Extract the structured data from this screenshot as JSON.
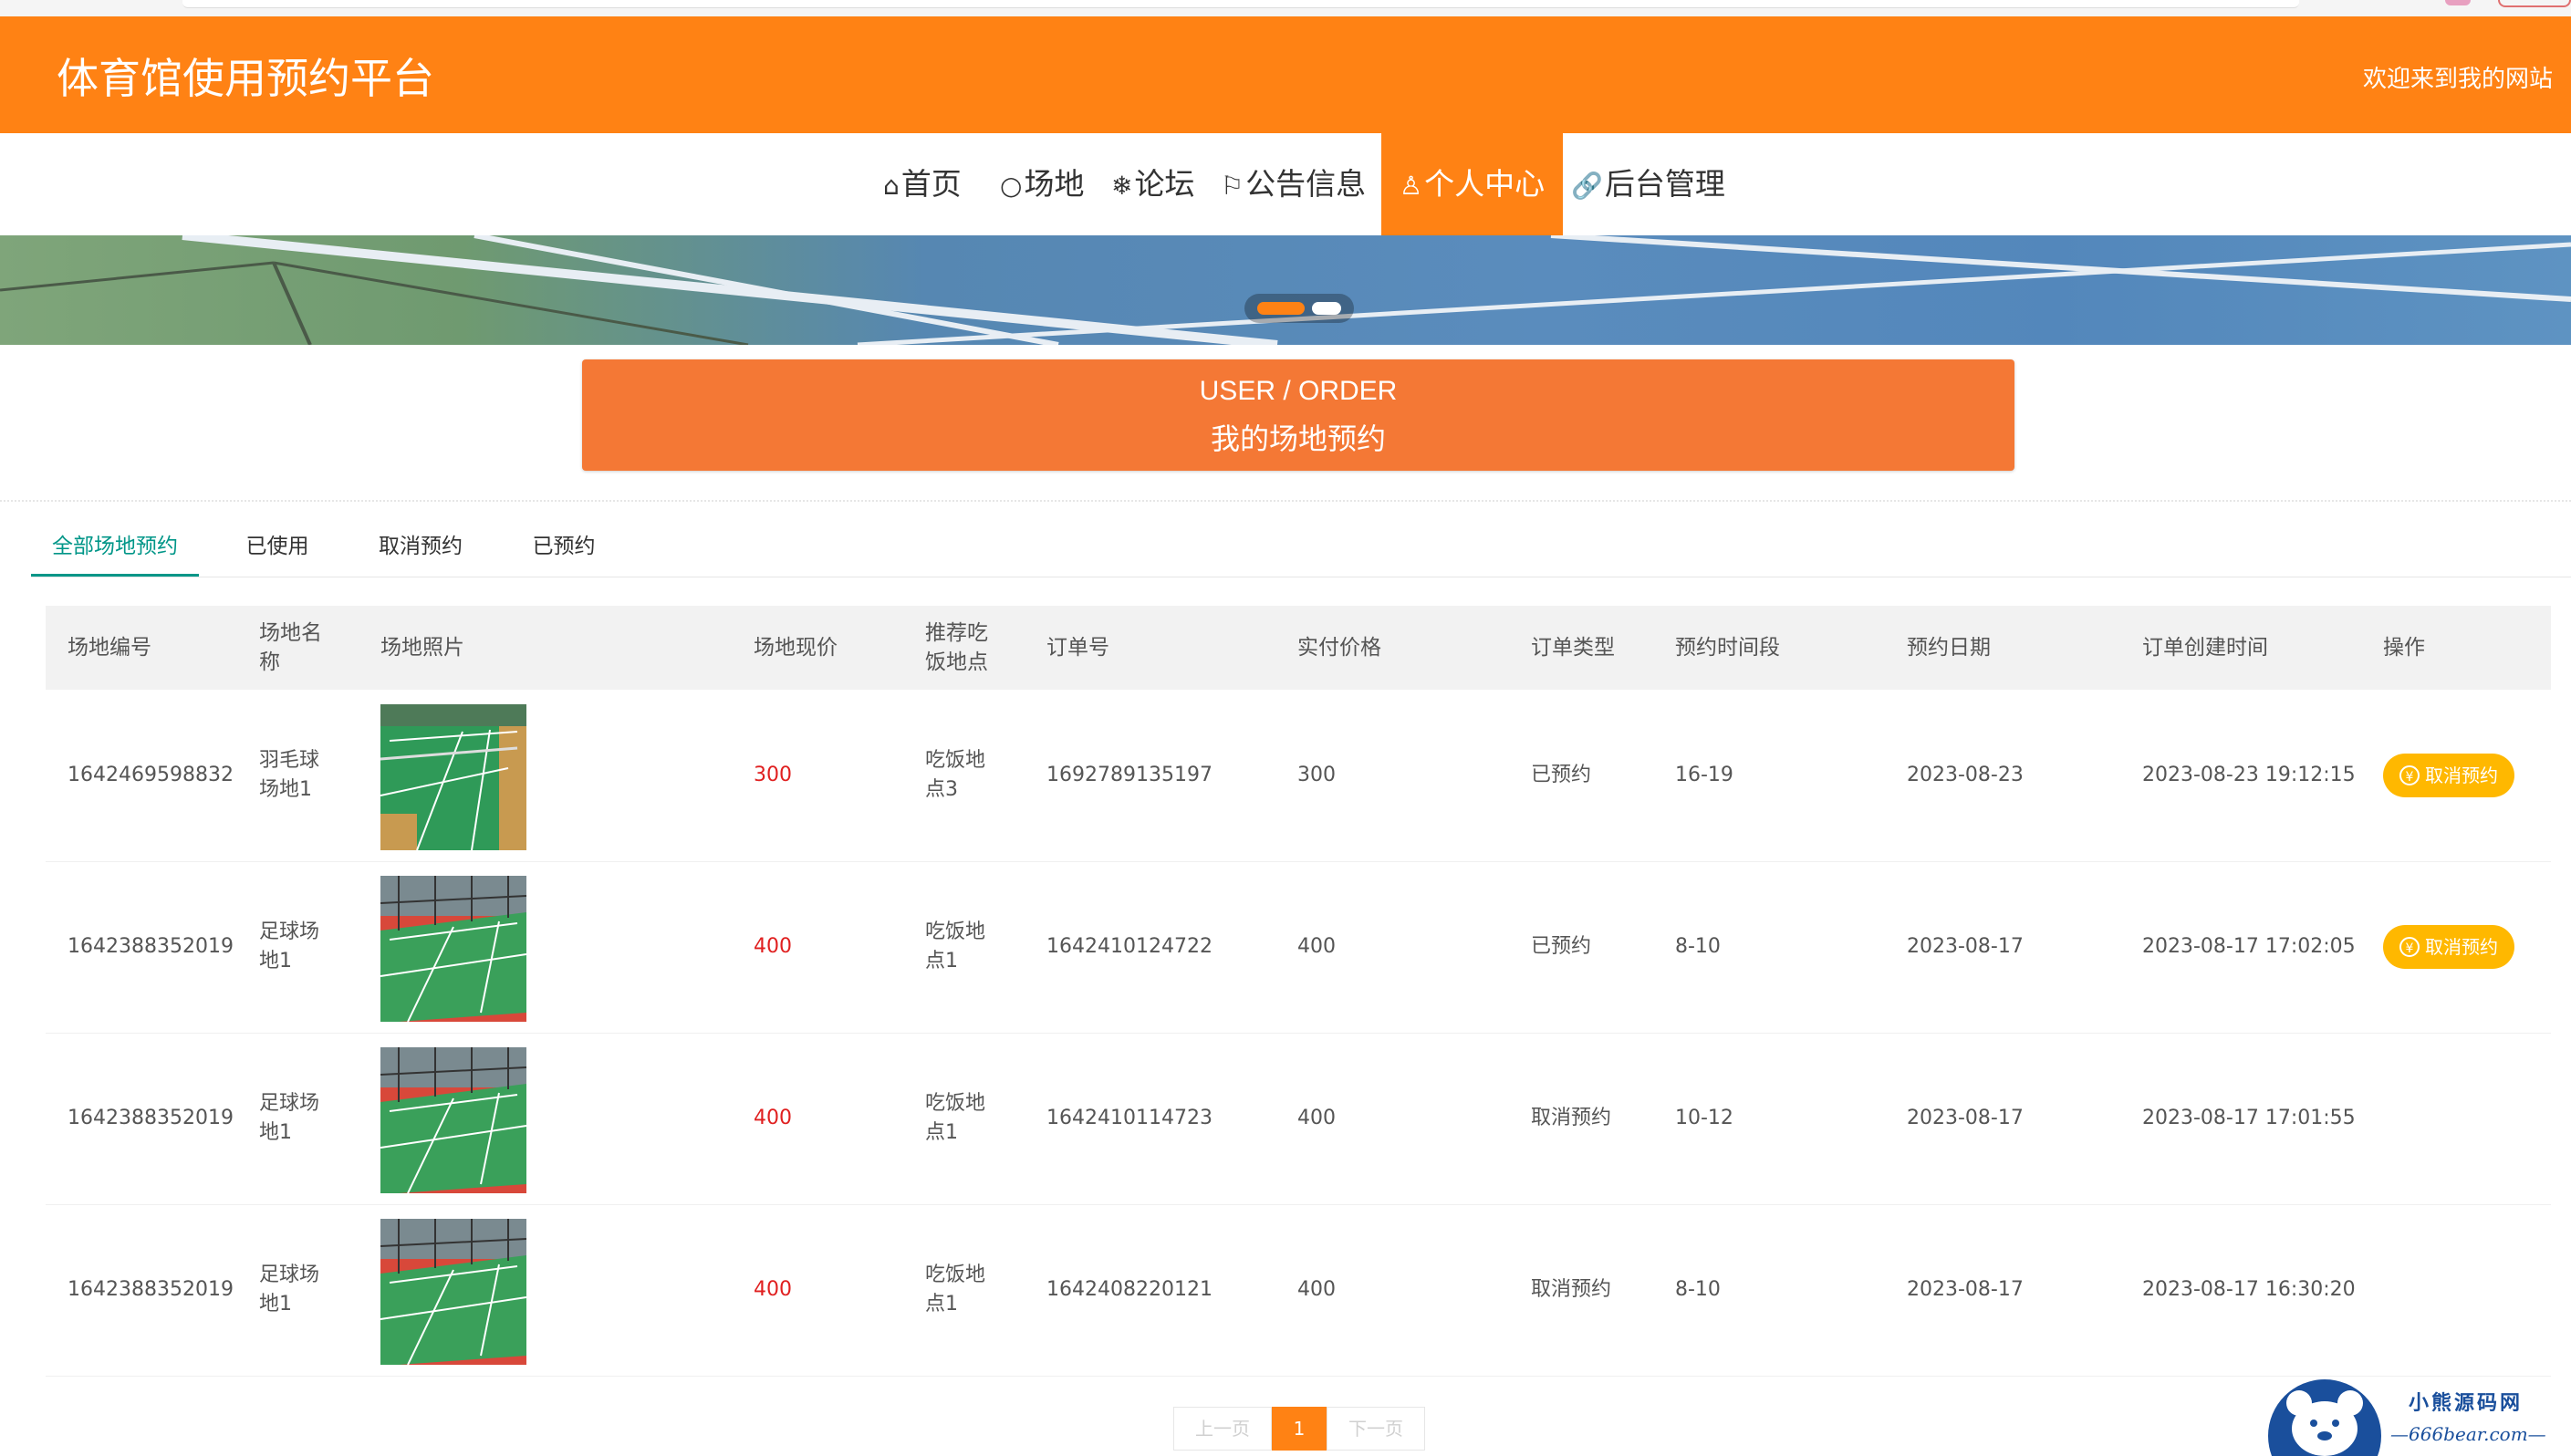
{
  "header": {
    "site_title": "体育馆使用预约平台",
    "welcome": "欢迎来到我的网站"
  },
  "nav": {
    "items": [
      {
        "label": "首页",
        "icon": "home-icon"
      },
      {
        "label": "场地",
        "icon": "circle-icon"
      },
      {
        "label": "论坛",
        "icon": "snowflake-icon"
      },
      {
        "label": "公告信息",
        "icon": "flag-icon"
      },
      {
        "label": "个人中心",
        "icon": "user-icon",
        "active": true
      },
      {
        "label": "后台管理",
        "icon": "link-icon"
      }
    ]
  },
  "banner": {
    "slides_total": 2,
    "active_slide": 1
  },
  "page_title": {
    "en": "USER / ORDER",
    "cn": "我的场地预约"
  },
  "tabs": [
    {
      "label": "全部场地预约",
      "active": true
    },
    {
      "label": "已使用"
    },
    {
      "label": "取消预约"
    },
    {
      "label": "已预约"
    }
  ],
  "table": {
    "headers": [
      "场地编号",
      "场地名称",
      "场地照片",
      "场地现价",
      "推荐吃饭地点",
      "订单号",
      "实付价格",
      "订单类型",
      "预约时间段",
      "预约日期",
      "订单创建时间",
      "操作"
    ],
    "rows": [
      {
        "venue_id": "1642469598832",
        "venue_name": "羽毛球场地1",
        "photo": "badminton-court",
        "price": "300",
        "food_spot": "吃饭地点3",
        "order_no": "1692789135197",
        "paid": "300",
        "order_type": "已预约",
        "time_slot": "16-19",
        "date": "2023-08-23",
        "created": "2023-08-23 19:12:15",
        "action": "取消预约"
      },
      {
        "venue_id": "1642388352019",
        "venue_name": "足球场地1",
        "photo": "court",
        "price": "400",
        "food_spot": "吃饭地点1",
        "order_no": "1642410124722",
        "paid": "400",
        "order_type": "已预约",
        "time_slot": "8-10",
        "date": "2023-08-17",
        "created": "2023-08-17 17:02:05",
        "action": "取消预约"
      },
      {
        "venue_id": "1642388352019",
        "venue_name": "足球场地1",
        "photo": "court",
        "price": "400",
        "food_spot": "吃饭地点1",
        "order_no": "1642410114723",
        "paid": "400",
        "order_type": "取消预约",
        "time_slot": "10-12",
        "date": "2023-08-17",
        "created": "2023-08-17 17:01:55",
        "action": ""
      },
      {
        "venue_id": "1642388352019",
        "venue_name": "足球场地1",
        "photo": "court",
        "price": "400",
        "food_spot": "吃饭地点1",
        "order_no": "1642408220121",
        "paid": "400",
        "order_type": "取消预约",
        "time_slot": "8-10",
        "date": "2023-08-17",
        "created": "2023-08-17 16:30:20",
        "action": ""
      }
    ]
  },
  "pagination": {
    "prev": "上一页",
    "current": "1",
    "next": "下一页"
  },
  "watermark": {
    "name": "小熊源码网",
    "domain": "—666bear.com—"
  },
  "colors": {
    "brand_orange": "#ff8214",
    "title_box": "#f47835",
    "tab_active": "#009688",
    "price_red": "#e02020",
    "cancel_button": "#ffb800"
  }
}
